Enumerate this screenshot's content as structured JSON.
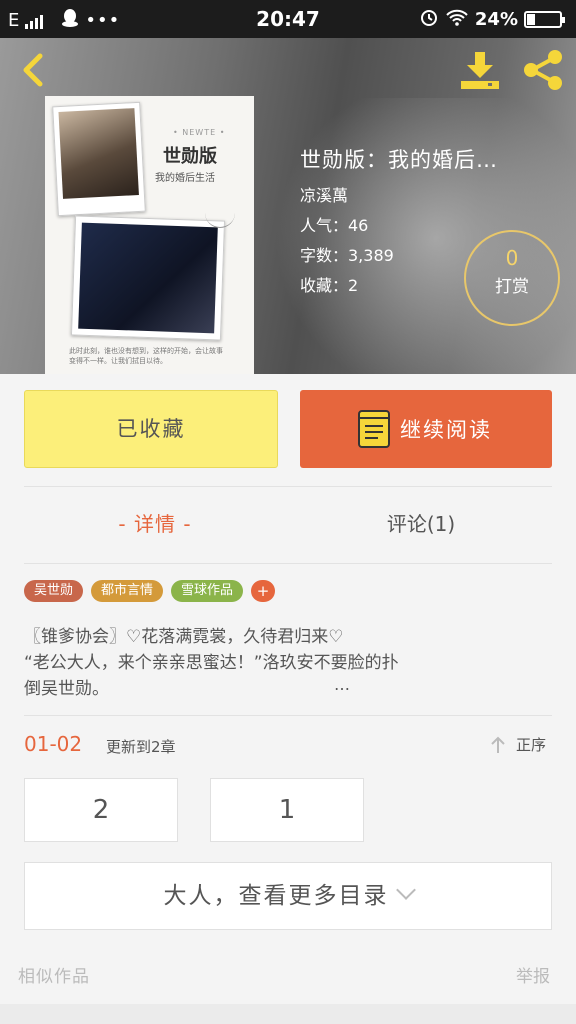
{
  "status_bar": {
    "network": "E",
    "time": "20:47",
    "battery": "24%",
    "battery_level": 0.24
  },
  "book": {
    "title": "世勋版：我的婚后…",
    "author": "凉溪萬",
    "popularity": "人气：46",
    "words": "字数：3,389",
    "favorites": "收藏：2"
  },
  "cover": {
    "series": "• NEWTE •",
    "title": "世勋版",
    "subtitle": "我的婚后生活",
    "note": "此时此刻，谁也没有想到，这样的开始，会让故事变得不一样。让我们拭目以待。"
  },
  "tip": {
    "count": "0",
    "label": "打赏"
  },
  "actions": {
    "favorited": "已收藏",
    "continue": "继续阅读"
  },
  "tabs": {
    "detail": "- 详情 -",
    "comments": "评论(1)"
  },
  "tags": [
    {
      "label": "吴世勋",
      "color": "#c8674b"
    },
    {
      "label": "都市言情",
      "color": "#d49a3a"
    },
    {
      "label": "雪球作品",
      "color": "#8bb44a"
    }
  ],
  "tag_more": "+",
  "intro": {
    "line1": "〖锥爹协会〗♡花落满霓裳，久待君归来♡",
    "line2": "“老公大人，来个亲亲思蜜达！”洛玖安不要脸的扑",
    "line3": "倒吴世勋。",
    "ellipsis": "…"
  },
  "update": {
    "date": "01-02",
    "text": "更新到2章",
    "sort": "正序"
  },
  "chapters": [
    "2",
    "1"
  ],
  "more_catalog": "大人，查看更多目录",
  "footer": {
    "similar": "相似作品",
    "report": "举报"
  },
  "colors": {
    "accent": "#e6663d",
    "yellow": "#fcef7a",
    "gold": "#e8c76a"
  }
}
